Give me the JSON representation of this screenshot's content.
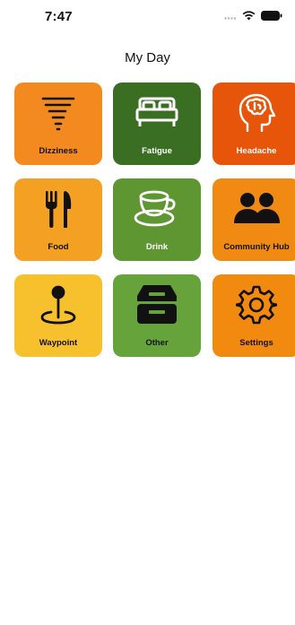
{
  "status_bar": {
    "time": "7:47"
  },
  "header": {
    "title": "My Day"
  },
  "tiles": [
    {
      "label": "Dizziness",
      "color": "#F28A1F",
      "icon": "tornado-icon",
      "dark": false
    },
    {
      "label": "Fatigue",
      "color": "#3A6E22",
      "icon": "bed-icon",
      "dark": true
    },
    {
      "label": "Headache",
      "color": "#E6550A",
      "icon": "brain-head-icon",
      "dark": true
    },
    {
      "label": "Food",
      "color": "#F4A123",
      "icon": "fork-knife-icon",
      "dark": false
    },
    {
      "label": "Drink",
      "color": "#5E9632",
      "icon": "cup-icon",
      "dark": true
    },
    {
      "label": "Community Hub",
      "color": "#F08A12",
      "icon": "people-icon",
      "dark": false
    },
    {
      "label": "Waypoint",
      "color": "#F6C12D",
      "icon": "map-pin-icon",
      "dark": false
    },
    {
      "label": "Other",
      "color": "#66A33A",
      "icon": "tray-icon",
      "dark": false
    },
    {
      "label": "Settings",
      "color": "#F28A10",
      "icon": "gear-icon",
      "dark": false
    }
  ]
}
